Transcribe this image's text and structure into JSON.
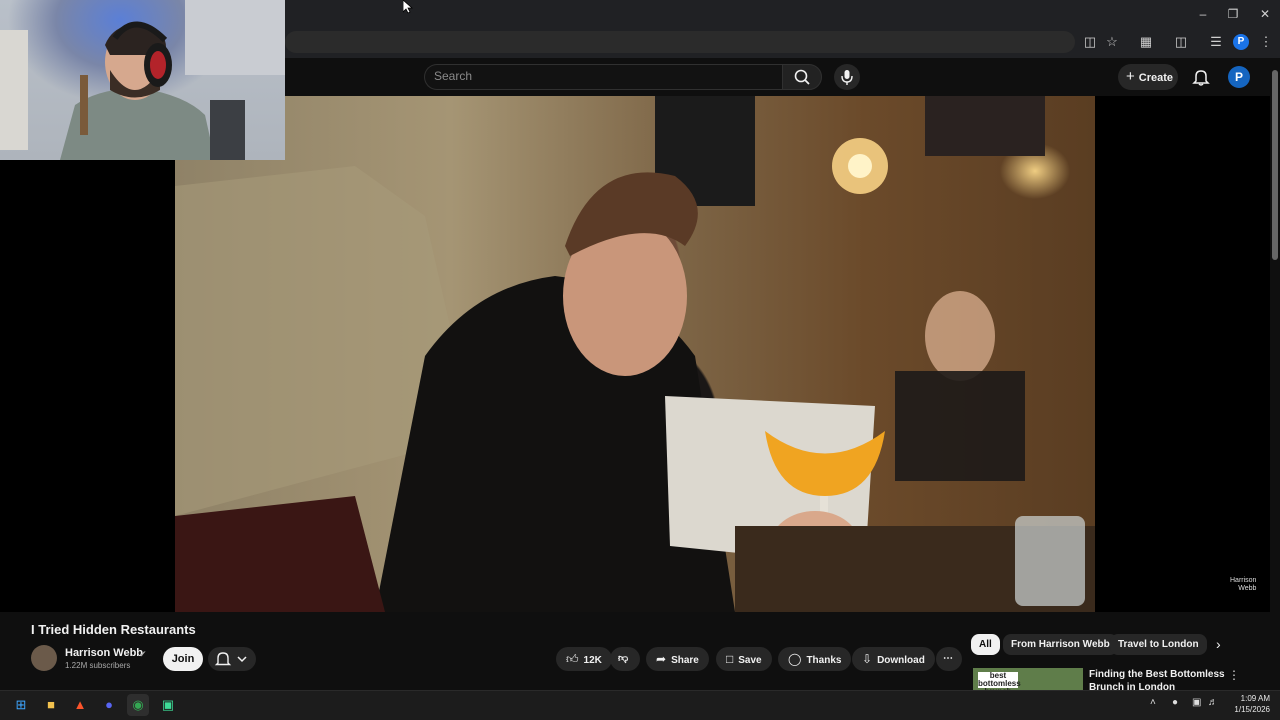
{
  "browser": {
    "window_controls": [
      "minimize",
      "restore",
      "close"
    ],
    "toolbar_icons": [
      "install-app-icon",
      "bookmark-star-icon",
      "extensions-icon",
      "side-panel-icon",
      "media-control-icon"
    ],
    "profile_initial": "P"
  },
  "masthead": {
    "search_placeholder": "Search",
    "create_label": "Create",
    "avatar_initial": "P"
  },
  "player": {
    "watermark_line1": "Harrison",
    "watermark_line2": "Webb"
  },
  "video": {
    "title": "I Tried Hidden Restaurants",
    "channel_name": "Harrison Webb",
    "subscribers": "1.22M subscribers",
    "join_label": "Join",
    "like_count": "12K",
    "share_label": "Share",
    "save_label": "Save",
    "thanks_label": "Thanks",
    "download_label": "Download"
  },
  "recommendations": {
    "chips": [
      "All",
      "From Harrison Webb",
      "Travel to London"
    ],
    "first_title": "Finding the Best Bottomless Brunch in London",
    "thumb_text": "best bottomless brunch"
  },
  "taskbar": {
    "apps": [
      "windows-start-icon",
      "file-explorer-icon",
      "brave-browser-icon",
      "discord-icon",
      "chrome-icon",
      "app-icon"
    ],
    "time": "1:09 AM",
    "date": "1/15/2026"
  }
}
